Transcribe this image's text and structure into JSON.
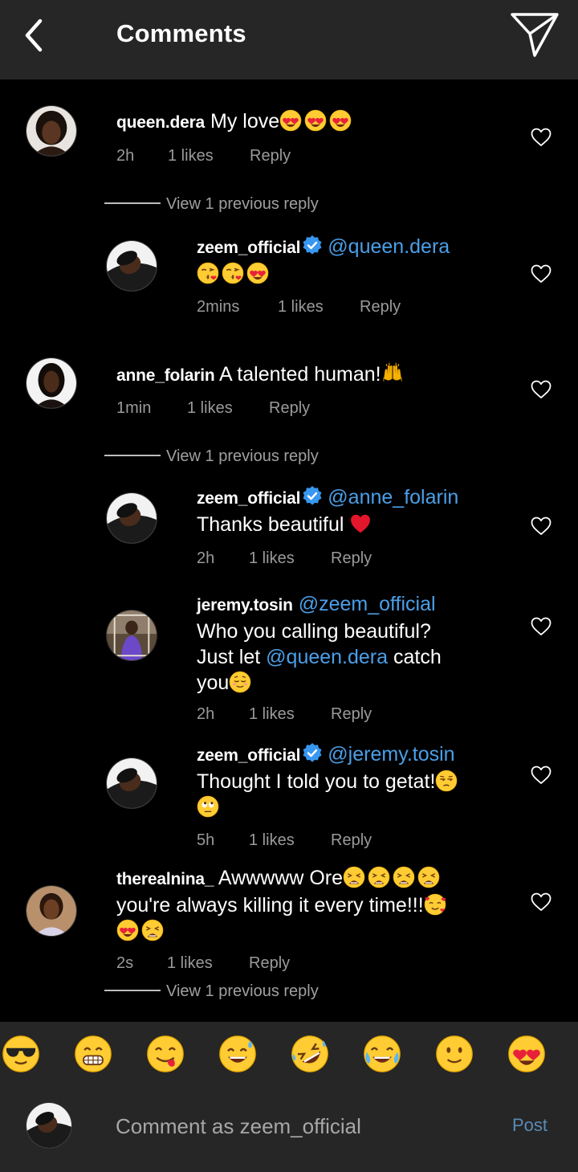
{
  "header": {
    "title": "Comments"
  },
  "comments": [
    {
      "username": "queen.dera",
      "text": "My love",
      "emojis": [
        "heart-eyes",
        "heart-eyes",
        "heart-eyes"
      ],
      "time": "2h",
      "likes": "1 likes",
      "reply": "Reply"
    },
    {
      "view_previous": "View 1 previous reply",
      "username": "zeem_official",
      "verified": true,
      "mention": "@queen.dera",
      "emojis": [
        "kiss-heart",
        "kiss-heart",
        "heart-eyes"
      ],
      "time": "2mins",
      "likes": "1 likes",
      "reply": "Reply"
    },
    {
      "username": "anne_folarin",
      "text": "A talented human!",
      "emojis": [
        "raised-hands"
      ],
      "time": "1min",
      "likes": "1 likes",
      "reply": "Reply"
    },
    {
      "view_previous": "View 1 previous reply",
      "username": "zeem_official",
      "verified": true,
      "mention": "@anne_folarin",
      "text": "Thanks beautiful",
      "emojis": [
        "red-heart"
      ],
      "time": "2h",
      "likes": "1 likes",
      "reply": "Reply"
    },
    {
      "username": "jeremy.tosin",
      "mention": "@zeem_official",
      "text_line1": "Who you calling beautiful?",
      "text_line2_a": "Just let",
      "text_line2_mention": "@queen.dera",
      "text_line2_b": "catch",
      "text_line3": "you",
      "emojis": [
        "relieved"
      ],
      "time": "2h",
      "likes": "1 likes",
      "reply": "Reply"
    },
    {
      "username": "zeem_official",
      "verified": true,
      "mention": "@jeremy.tosin",
      "text": "Thought I told you to getat!",
      "emojis": [
        "unamused",
        "eye-roll"
      ],
      "time": "5h",
      "likes": "1 likes",
      "reply": "Reply"
    },
    {
      "username": "therealnina_",
      "text_line1": "Awwwww Ore",
      "text_line2": "you're always killing it every time!!!",
      "emojis": [
        "weary",
        "weary",
        "weary",
        "weary",
        "smiling-hearts",
        "heart-eyes",
        "weary"
      ],
      "time": "2s",
      "likes": "1 likes",
      "reply": "Reply",
      "view_previous": "View 1 previous reply"
    }
  ],
  "emoji_bar": [
    "sunglasses",
    "grin",
    "yum",
    "sweat-smile",
    "rofl",
    "joy",
    "slight-smile",
    "heart-eyes"
  ],
  "composer": {
    "placeholder": "Comment as zeem_official",
    "post_label": "Post"
  },
  "colors": {
    "background": "#000000",
    "bar": "#262626",
    "mention": "#4a9fe8",
    "meta": "#9a9a9a",
    "post": "#5a8bb5"
  }
}
